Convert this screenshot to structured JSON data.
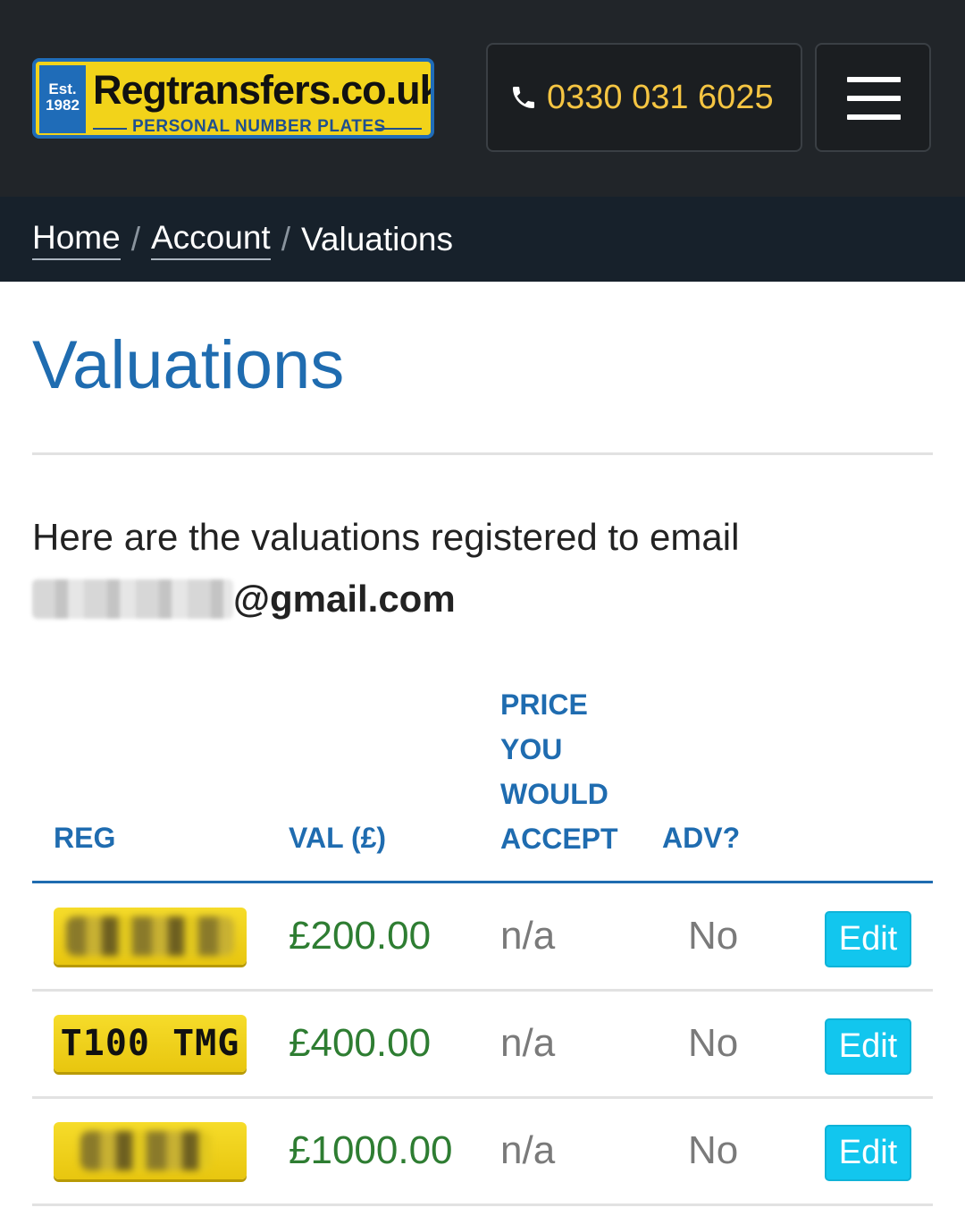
{
  "header": {
    "logo": {
      "est": "Est. 1982",
      "name": "Regtransfers.co.uk",
      "subtitle": "PERSONAL NUMBER PLATES"
    },
    "phone": "0330 031 6025",
    "phone_icon": "phone-icon",
    "menu_icon": "hamburger-menu-icon"
  },
  "breadcrumb": {
    "items": [
      "Home",
      "Account",
      "Valuations"
    ],
    "separator": "/"
  },
  "page": {
    "title": "Valuations",
    "intro_text": "Here are the valuations registered to email",
    "email_suffix": "@gmail.com"
  },
  "table": {
    "headers": {
      "reg": "REG",
      "val": "VAL (£)",
      "price_line1": "PRICE",
      "price_line2": "YOU",
      "price_line3": "WOULD",
      "price_line4": "ACCEPT",
      "adv": "ADV?"
    },
    "rows": [
      {
        "reg": "",
        "val": "£200.00",
        "price": "n/a",
        "adv": "No",
        "action": "Edit"
      },
      {
        "reg": "T100 TMG",
        "val": "£400.00",
        "price": "n/a",
        "adv": "No",
        "action": "Edit"
      },
      {
        "reg": "",
        "val": "£1000.00",
        "price": "n/a",
        "adv": "No",
        "action": "Edit"
      }
    ]
  },
  "colors": {
    "header_bg": "#212529",
    "breadcrumb_bg": "#17212b",
    "title_blue": "#1f6cb0",
    "phone_yellow": "#f5c542",
    "value_green": "#2e7d32",
    "edit_button": "#12c6ee",
    "plate_yellow": "#f2d31a"
  }
}
